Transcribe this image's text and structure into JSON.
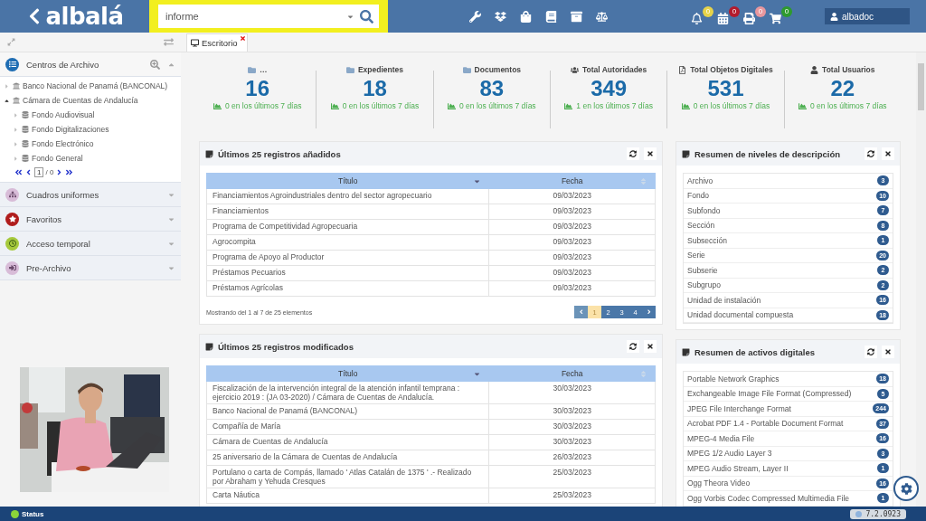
{
  "header": {
    "logo": "albalá",
    "search": {
      "value": "informe",
      "highlighted": true
    },
    "tools": [
      {
        "kind": "wrench"
      },
      {
        "kind": "dropbox"
      },
      {
        "kind": "bag"
      },
      {
        "kind": "book"
      },
      {
        "kind": "archive"
      },
      {
        "kind": "scale"
      }
    ],
    "notifications": [
      {
        "kind": "bell",
        "count": "0",
        "color": "#e6d34a"
      },
      {
        "kind": "calendar",
        "count": "0",
        "color": "#b31b2c"
      },
      {
        "kind": "printer",
        "count": "0",
        "color": "#e8979e"
      },
      {
        "kind": "cart",
        "count": "0",
        "color": "#2e9a2e"
      }
    ],
    "user": "albadoc"
  },
  "sidebar": {
    "sections": [
      {
        "label": "Centros de Archivo",
        "kind": "list",
        "color": "#1f6db3",
        "expanded": true
      },
      {
        "label": "Cuadros uniformes",
        "kind": "sitemap",
        "color": "#d8bcd8",
        "expanded": false
      },
      {
        "label": "Favoritos",
        "kind": "star",
        "color": "#b01c1c",
        "expanded": false
      },
      {
        "label": "Acceso temporal",
        "kind": "clock",
        "color": "#a6c93c",
        "expanded": false
      },
      {
        "label": "Pre-Archivo",
        "kind": "enter",
        "color": "#d8bcd8",
        "expanded": false
      }
    ],
    "tree": [
      {
        "label": "Banco Nacional de Panamá (BANCONAL)",
        "expanded": false
      },
      {
        "label": "Cámara de Cuentas de Andalucía",
        "expanded": true,
        "children": [
          {
            "label": "Fondo Audiovisual",
            "expanded": false
          },
          {
            "label": "Fondo Digitalizaciones",
            "expanded": false
          },
          {
            "label": "Fondo Electrónico",
            "expanded": false
          },
          {
            "label": "Fondo General",
            "expanded": false
          }
        ]
      }
    ],
    "pager": {
      "page": "1",
      "total": "/ 0"
    }
  },
  "tabs": [
    {
      "label": "Escritorio",
      "selected": true
    }
  ],
  "stats": [
    {
      "kind": "folder",
      "label": "…",
      "value": "16",
      "trend": "0 en los últimos 7 días"
    },
    {
      "kind": "folder",
      "label": "Expedientes",
      "value": "18",
      "trend": "0 en los últimos 7 días"
    },
    {
      "kind": "folder",
      "label": "Documentos",
      "value": "83",
      "trend": "0 en los últimos 7 días"
    },
    {
      "kind": "users",
      "label": "Total Autoridades",
      "value": "349",
      "trend": "1 en los últimos 7 días"
    },
    {
      "kind": "pdf",
      "label": "Total Objetos Digitales",
      "value": "531",
      "trend": "0 en los últimos 7 días"
    },
    {
      "kind": "user",
      "label": "Total Usuarios",
      "value": "22",
      "trend": "0 en los últimos 7 días"
    }
  ],
  "panels_left": [
    {
      "title": "Últimos 25 registros añadidos",
      "columns": [
        "Título",
        "Fecha"
      ],
      "rows": [
        [
          "Financiamientos Agroindustriales dentro del sector agropecuario",
          "09/03/2023"
        ],
        [
          "Financiamientos",
          "09/03/2023"
        ],
        [
          "Programa de Competitividad Agropecuaria",
          "09/03/2023"
        ],
        [
          "Agrocompita",
          "09/03/2023"
        ],
        [
          "Programa de Apoyo al Productor",
          "09/03/2023"
        ],
        [
          "Préstamos Pecuarios",
          "09/03/2023"
        ],
        [
          "Préstamos Agrícolas",
          "09/03/2023"
        ]
      ],
      "footer": "Mostrando del 1 al 7 de 25 elementos",
      "pages": [
        {
          "label": "1",
          "selected": true
        },
        {
          "label": "2",
          "selected": false
        },
        {
          "label": "3",
          "selected": false
        },
        {
          "label": "4",
          "selected": false
        }
      ]
    },
    {
      "title": "Últimos 25 registros modificados",
      "columns": [
        "Título",
        "Fecha"
      ],
      "rows": [
        [
          "Fiscalización de la intervención integral de la atención infantil temprana : ejercicio 2019 : (JA 03-2020) / Cámara de Cuentas de Andalucía.",
          "30/03/2023"
        ],
        [
          "Banco Nacional de Panamá (BANCONAL)",
          "30/03/2023"
        ],
        [
          "Compañía de María",
          "30/03/2023"
        ],
        [
          "Cámara de Cuentas de Andalucía",
          "30/03/2023"
        ],
        [
          "25 aniversario de la Cámara de Cuentas de Andalucía",
          "26/03/2023"
        ],
        [
          "Portulano o carta de Compás, llamado ' Atlas Catalán de 1375 ' .- Realizado por Abraham y Yehuda Cresques",
          "25/03/2023"
        ],
        [
          "Carta Náutica",
          "25/03/2023"
        ]
      ]
    }
  ],
  "panels_right": [
    {
      "title": "Resumen de niveles de descripción",
      "items": [
        {
          "label": "Archivo",
          "count": "3"
        },
        {
          "label": "Fondo",
          "count": "10"
        },
        {
          "label": "Subfondo",
          "count": "7"
        },
        {
          "label": "Sección",
          "count": "8"
        },
        {
          "label": "Subsección",
          "count": "1"
        },
        {
          "label": "Serie",
          "count": "20"
        },
        {
          "label": "Subserie",
          "count": "2"
        },
        {
          "label": "Subgrupo",
          "count": "2"
        },
        {
          "label": "Unidad de instalación",
          "count": "16"
        },
        {
          "label": "Unidad documental compuesta",
          "count": "18"
        }
      ]
    },
    {
      "title": "Resumen de activos digitales",
      "items": [
        {
          "label": "Portable Network Graphics",
          "count": "18"
        },
        {
          "label": "Exchangeable Image File Format (Compressed)",
          "count": "5"
        },
        {
          "label": "JPEG File Interchange Format",
          "count": "244"
        },
        {
          "label": "Acrobat PDF 1.4 - Portable Document Format",
          "count": "37"
        },
        {
          "label": "MPEG-4 Media File",
          "count": "16"
        },
        {
          "label": "MPEG 1/2 Audio Layer 3",
          "count": "3"
        },
        {
          "label": "MPEG Audio Stream, Layer II",
          "count": "1"
        },
        {
          "label": "Ogg Theora Video",
          "count": "16"
        },
        {
          "label": "Ogg Vorbis Codec Compressed Multimedia File",
          "count": "1"
        }
      ]
    }
  ],
  "status_bar": {
    "label": "Status",
    "version": "7.2.0923"
  }
}
